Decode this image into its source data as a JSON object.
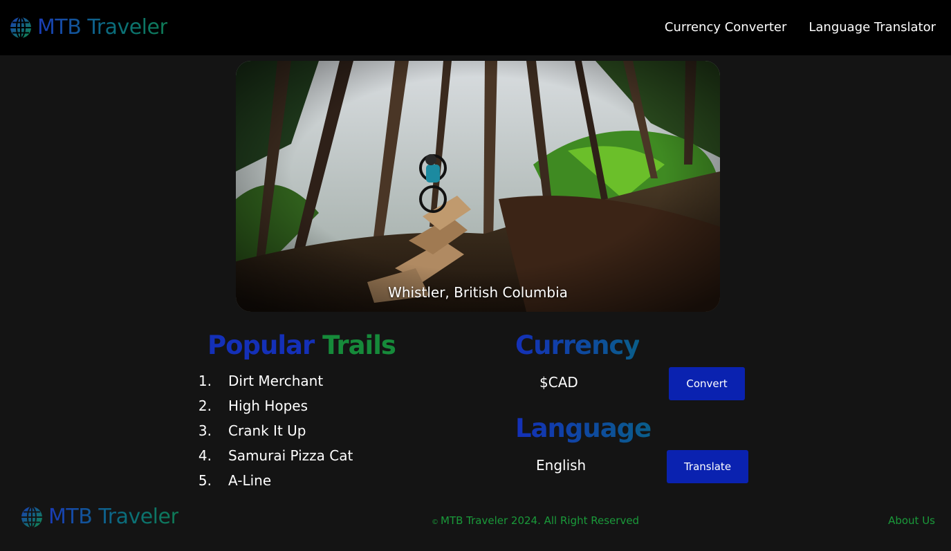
{
  "header": {
    "brand": "MTB Traveler",
    "nav": [
      {
        "label": "Currency Converter"
      },
      {
        "label": "Language Translator"
      }
    ]
  },
  "hero": {
    "caption": "Whistler, British Columbia",
    "image_icon": "forest-photo"
  },
  "trails": {
    "heading_part1": "Popular",
    "heading_part2": "Trails",
    "items": [
      {
        "num": "1.",
        "name": "Dirt Merchant"
      },
      {
        "num": "2.",
        "name": "High Hopes"
      },
      {
        "num": "3.",
        "name": "Crank It Up"
      },
      {
        "num": "4.",
        "name": "Samurai Pizza Cat"
      },
      {
        "num": "5.",
        "name": "A-Line"
      }
    ]
  },
  "currency": {
    "heading": "Currency",
    "value": "$CAD",
    "button": "Convert"
  },
  "language": {
    "heading": "Language",
    "value": "English",
    "button": "Translate"
  },
  "footer": {
    "brand": "MTB Traveler",
    "copyright_symbol": "©",
    "copyright": "MTB Traveler 2024. All Right Reserved",
    "about": "About Us"
  },
  "colors": {
    "header_bg": "#000000",
    "page_bg": "#141414",
    "accent_blue": "#1430b8",
    "accent_green": "#168a3a",
    "button_bg": "#0a22b0",
    "footer_text": "#1a9a3a"
  }
}
